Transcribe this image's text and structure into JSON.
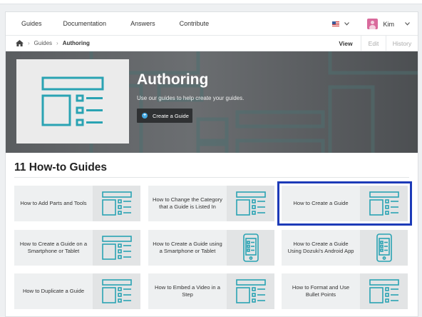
{
  "nav": {
    "items": [
      "Guides",
      "Documentation",
      "Answers",
      "Contribute"
    ],
    "user": "Kim"
  },
  "breadcrumb": {
    "items": [
      "Guides",
      "Authoring"
    ]
  },
  "view_tabs": [
    "View",
    "Edit",
    "History"
  ],
  "hero": {
    "title": "Authoring",
    "subtitle": "Use our guides to help create your guides.",
    "button": "Create a Guide"
  },
  "guides": {
    "heading": "11 How-to Guides",
    "cards": [
      {
        "title": "How to Add Parts and Tools",
        "icon": "guide-layout-icon"
      },
      {
        "title": "How to Change the Category that a Guide is Listed In",
        "icon": "guide-layout-icon"
      },
      {
        "title": "How to Create a Guide",
        "icon": "guide-layout-icon",
        "highlighted": true
      },
      {
        "title": "How to Create a Guide on a Smartphone or Tablet",
        "icon": "guide-layout-icon"
      },
      {
        "title": "How to Create a Guide using a Smartphone or Tablet",
        "icon": "phone-icon"
      },
      {
        "title": "How to Create a Guide Using Dozuki's Android App",
        "icon": "phone-icon"
      },
      {
        "title": "How to Duplicate a Guide",
        "icon": "guide-layout-icon"
      },
      {
        "title": "How to Embed a Video in a Step",
        "icon": "guide-layout-icon"
      },
      {
        "title": "How to Format and Use Bullet Points",
        "icon": "guide-layout-icon"
      }
    ]
  },
  "colors": {
    "accent_teal": "#2aa3b3",
    "highlight_blue": "#1d3bb8",
    "button_plus": "#43a7e0"
  }
}
